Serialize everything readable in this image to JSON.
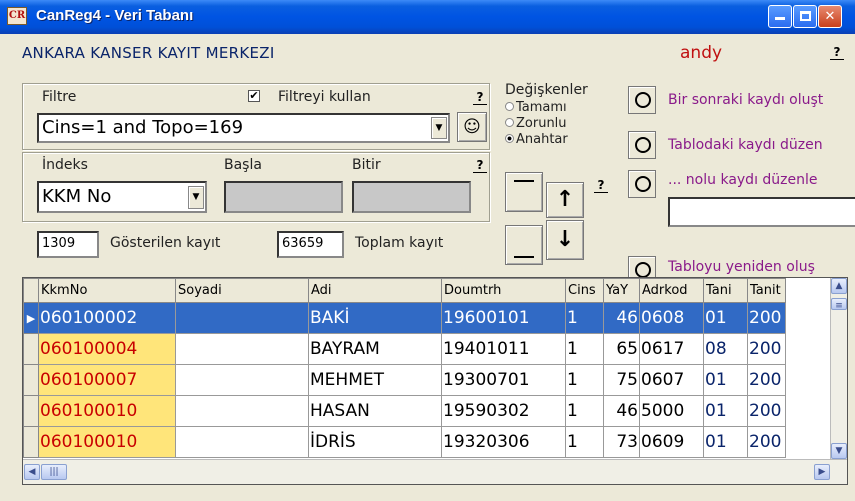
{
  "window": {
    "title": "CanReg4 - Veri Tabanı",
    "icon": "canreg-app-icon"
  },
  "header": {
    "org": "ANKARA KANSER KAYIT MERKEZI",
    "user": "andy",
    "help": "?"
  },
  "filter": {
    "label": "Filtre",
    "use_label": "Filtreyi kullan",
    "use_checked": true,
    "value": "Cins=1 and Topo=169",
    "help": "?"
  },
  "index": {
    "label": "İndeks",
    "start_label": "Başla",
    "end_label": "Bitir",
    "selected": "KKM No",
    "help": "?"
  },
  "counts": {
    "shown_value": "1309",
    "shown_label": "Gösterilen kayıt",
    "total_value": "63659",
    "total_label": "Toplam kayıt"
  },
  "variables": {
    "label": "Değişkenler",
    "options": [
      "Tamamı",
      "Zorunlu",
      "Anahtar"
    ],
    "selected": "Anahtar",
    "nav_help": "?"
  },
  "actions": [
    "Bir sonraki kaydı oluşt",
    "Tablodaki kaydı düzen",
    "... nolu kaydı düzenle",
    "Tabloyu yeniden oluş"
  ],
  "grid": {
    "columns": [
      "KkmNo",
      "Soyadi",
      "Adi",
      "Doumtrh",
      "Cins",
      "YaY",
      "Adrkod",
      "Tani",
      "Tanit"
    ],
    "rows": [
      [
        "060100002",
        "",
        "BAKİ",
        "19600101",
        "1",
        "46",
        "0608",
        "01",
        "200"
      ],
      [
        "060100004",
        "",
        "BAYRAM",
        "19401011",
        "1",
        "65",
        "0617",
        "08",
        "200"
      ],
      [
        "060100007",
        "",
        "MEHMET",
        "19300701",
        "1",
        "75",
        "0607",
        "01",
        "200"
      ],
      [
        "060100010",
        "",
        "HASAN",
        "19590302",
        "1",
        "46",
        "5000",
        "01",
        "200"
      ],
      [
        "060100010",
        "",
        "İDRİS",
        "19320306",
        "1",
        "73",
        "0609",
        "01",
        "200"
      ]
    ],
    "selected_row": 0
  },
  "colors": {
    "title_bar": "#0054e3",
    "selection": "#316ac5",
    "key_cell": "#ffe57a",
    "key_text": "#c80000",
    "action_text": "#8a1a8a"
  }
}
